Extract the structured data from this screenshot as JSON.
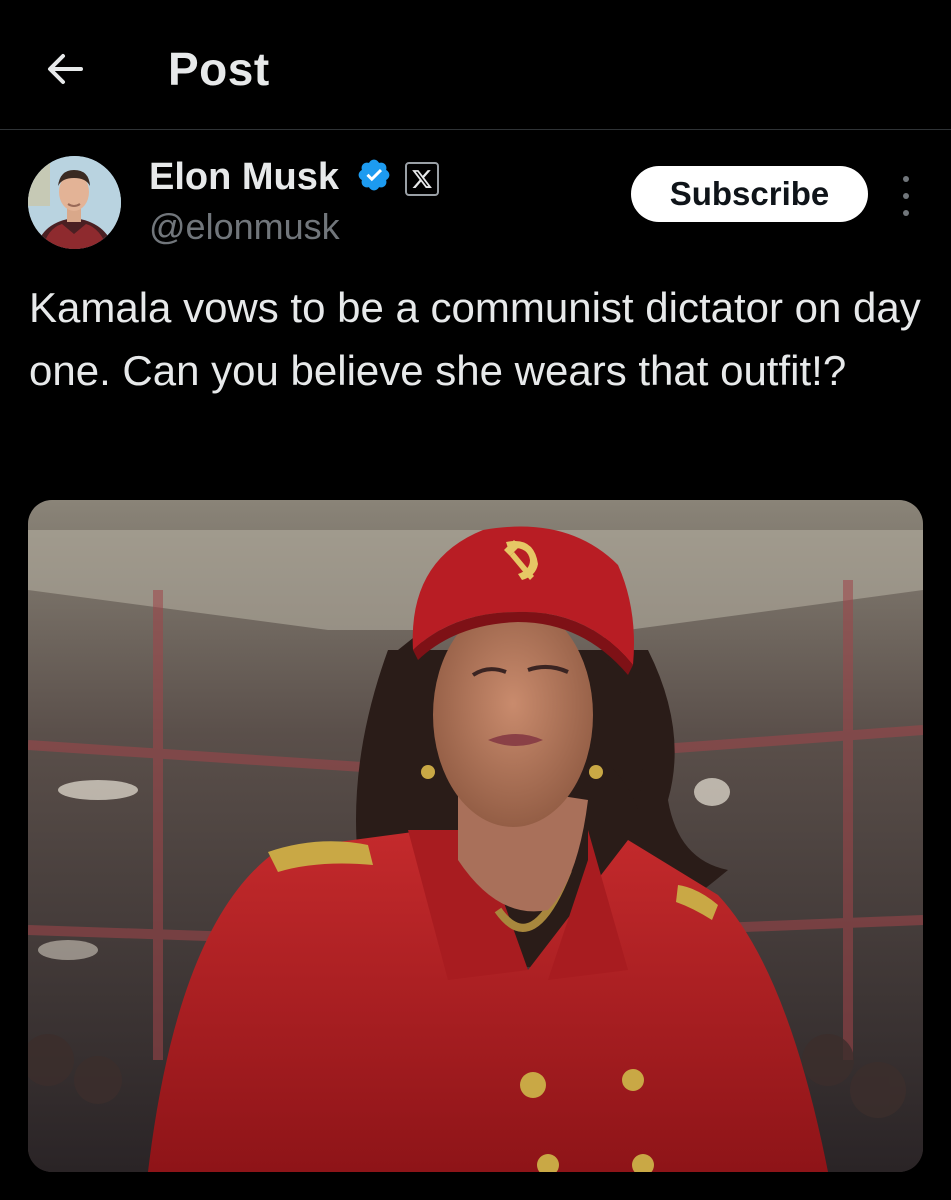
{
  "header": {
    "title": "Post",
    "back_icon": "arrow-left-icon"
  },
  "author": {
    "name": "Elon Musk",
    "handle": "@elonmusk",
    "verified_icon": "verified-badge-icon",
    "affiliate_icon": "x-logo-icon",
    "verified_color": "#1d9bf0"
  },
  "actions": {
    "subscribe_label": "Subscribe",
    "more_icon": "more-vertical-icon"
  },
  "post": {
    "text": "Kamala vows to be a communist dictator on day one. Can you believe she wears that outfit!?"
  },
  "media": {
    "icon": "hammer-sickle-icon",
    "accent_color": "#b81d24"
  }
}
